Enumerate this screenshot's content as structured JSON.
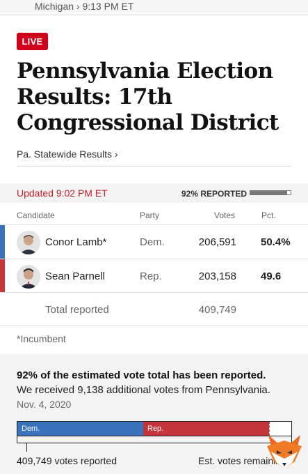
{
  "topbar": {
    "breadcrumb": "Michigan › 9:13 PM ET"
  },
  "live_badge": "LIVE",
  "headline": "Pennsylvania Election Results: 17th Congressional District",
  "statewide_link": "Pa. Statewide Results ›",
  "status": {
    "updated": "Updated 9:02 PM ET",
    "reported": "92% REPORTED",
    "reported_fraction": 0.92
  },
  "table": {
    "headers": {
      "candidate": "Candidate",
      "party": "Party",
      "votes": "Votes",
      "pct": "Pct."
    },
    "rows": [
      {
        "candidate": "Conor Lamb*",
        "party": "Dem.",
        "votes": "206,591",
        "pct": "50.4%",
        "color": "#3a73bb"
      },
      {
        "candidate": "Sean Parnell",
        "party": "Rep.",
        "votes": "203,158",
        "pct": "49.6",
        "color": "#c4343a"
      }
    ],
    "total_label": "Total reported",
    "total_votes": "409,749"
  },
  "footnote": "*Incumbent",
  "estimate": {
    "title": "92% of the estimated vote total has been reported.",
    "subtitle": "We received 9,138 additional votes from Pennsylvania.",
    "date": "Nov. 4, 2020",
    "bar": {
      "dem_label": "Dem.",
      "rep_label": "Rep.",
      "dem_share": 0.46,
      "rep_share": 0.46,
      "remaining_share": 0.08
    },
    "votes_reported": "409,749 votes reported",
    "est_remaining": "Est. votes remaining"
  },
  "colors": {
    "dem": "#3a73bb",
    "rep": "#c4343a",
    "live": "#d0021b",
    "updated": "#c4202e"
  }
}
